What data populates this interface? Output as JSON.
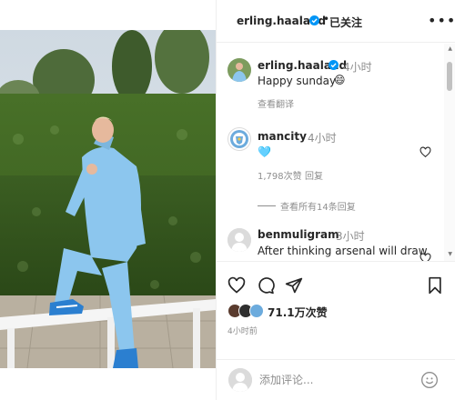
{
  "header": {
    "username": "erling.haaland",
    "separator": "•",
    "follow_state": "已关注",
    "more_icon": "more-dots-icon"
  },
  "caption": {
    "username": "erling.haaland",
    "time": "4小时",
    "text": "Happy sunday",
    "emoji": "😄",
    "translate": "查看翻译"
  },
  "comments": [
    {
      "username": "mancity",
      "time": "4小时",
      "text": "🩵",
      "likes": "1,798次赞",
      "reply": "回复",
      "view_replies": "查看所有14条回复"
    },
    {
      "username": "benmuligram",
      "time": "3小时",
      "text": "After thinking arsenal will draw"
    }
  ],
  "actions": {
    "likes": "71.1万次赞",
    "post_time": "4小时前"
  },
  "composer": {
    "placeholder": "添加评论..."
  },
  "colors": {
    "accent": "#0095f6",
    "sky_blue": "#87c4ef",
    "text": "#262626",
    "muted": "#8e8e8e"
  }
}
